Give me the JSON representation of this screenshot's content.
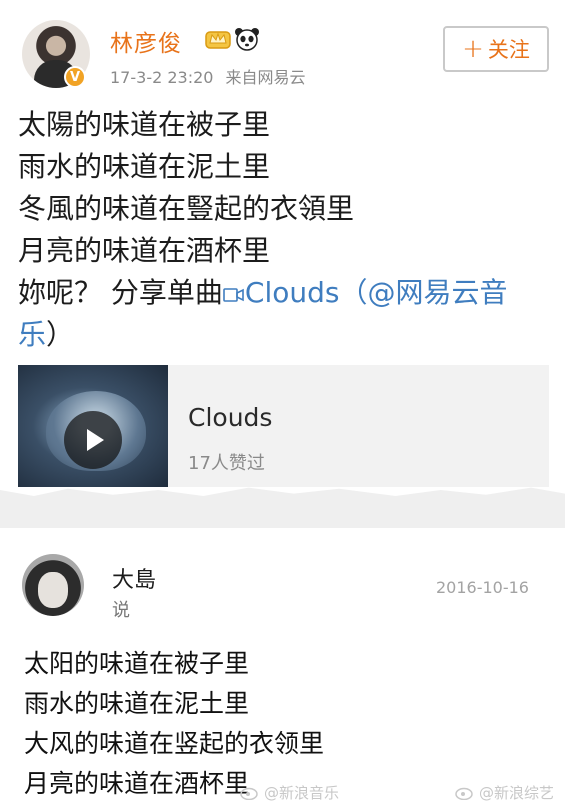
{
  "post1": {
    "author": "林彦俊",
    "verified_badge": "V",
    "time": "17-3-2 23:20",
    "source": "来自网易云",
    "follow_label": "关注",
    "follow_plus": "+",
    "lines": [
      "太陽的味道在被子里",
      "雨水的味道在泥土里",
      "冬風的味道在豎起的衣領里",
      "月亮的味道在酒杯里"
    ],
    "share_prefix": "妳呢？ 分享单曲",
    "song_link": "Clouds",
    "mention_open": "（",
    "mention": "@网易云音乐",
    "mention_close": "）",
    "card": {
      "title": "Clouds",
      "likes": "17人赞过"
    },
    "colors": {
      "name": "#e8731a",
      "link": "#3f7dbf",
      "badge": "#f1a325"
    }
  },
  "post2": {
    "author": "大島",
    "action": "说",
    "date": "2016-10-16",
    "lines": [
      "太阳的味道在被子里",
      "雨水的味道在泥土里",
      "大风的味道在竖起的衣领里",
      "月亮的味道在酒杯里"
    ]
  },
  "watermarks": [
    "@新浪音乐",
    "@新浪综艺"
  ]
}
